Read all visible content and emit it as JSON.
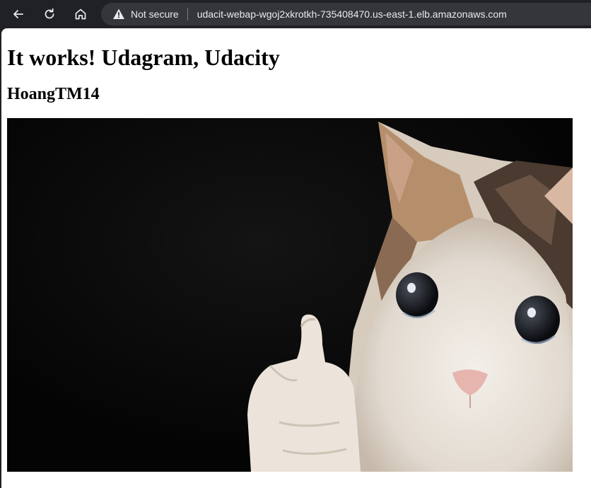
{
  "browser": {
    "security_label": "Not secure",
    "url": "udacit-webap-wgoj2xkrotkh-735408470.us-east-1.elb.amazonaws.com",
    "icons": [
      "back-arrow-icon",
      "reload-icon",
      "home-icon",
      "warning-icon"
    ]
  },
  "page": {
    "title": "It works! Udagram, Udacity",
    "subtitle": "HoangTM14",
    "image": {
      "subject": "crying-cat-thumbs-up"
    }
  },
  "colors": {
    "browser_chrome": "#202124",
    "omnibox": "#35363a",
    "page_background": "#ffffff",
    "image_background": "#050505"
  }
}
